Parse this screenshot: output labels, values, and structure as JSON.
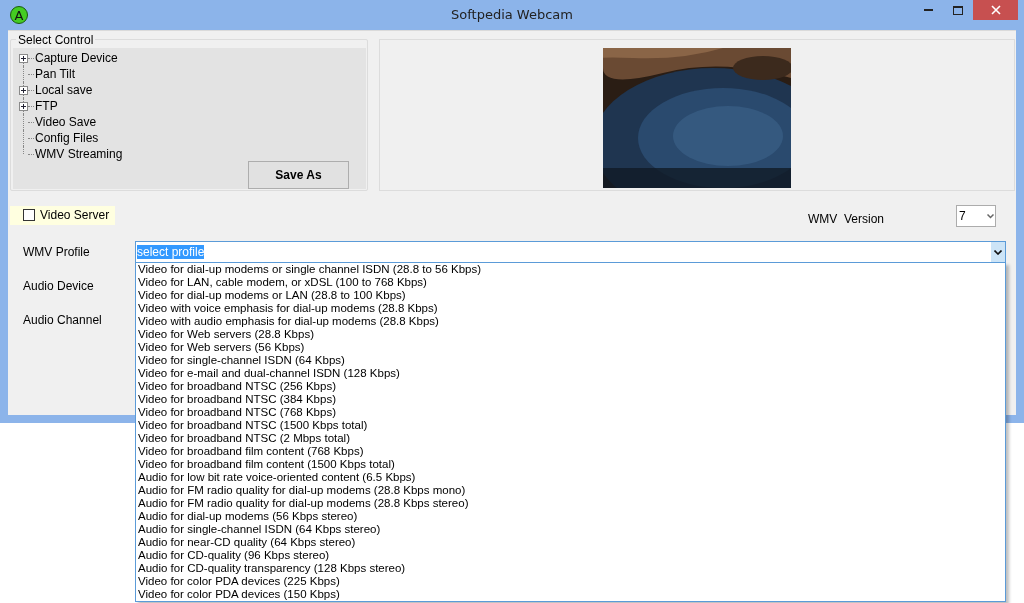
{
  "window": {
    "title": "Softpedia Webcam",
    "icon_letter": "A"
  },
  "select_control": {
    "title": "Select Control",
    "items": [
      {
        "label": "Capture Device",
        "kind": "expandable",
        "expanded": false
      },
      {
        "label": "Pan Tilt",
        "kind": "leaf"
      },
      {
        "label": "Local save",
        "kind": "expandable",
        "expanded": false
      },
      {
        "label": "FTP",
        "kind": "expandable",
        "expanded": false
      },
      {
        "label": "Video Save",
        "kind": "leaf"
      },
      {
        "label": "Config Files",
        "kind": "leaf"
      },
      {
        "label": "WMV Streaming",
        "kind": "leaf"
      }
    ],
    "save_button": "Save As"
  },
  "video_server": {
    "label": "Video Server",
    "checked": false
  },
  "wmv_version": {
    "label": "WMV  Version",
    "value": "7"
  },
  "wmv_profile": {
    "label": "WMV Profile",
    "value": "select profile",
    "expanded": true,
    "options": [
      "Video for dial-up modems or single channel ISDN (28.8 to 56 Kbps)",
      "Video for LAN, cable modem, or xDSL (100 to 768 Kbps)",
      "Video for dial-up modems or LAN (28.8 to 100 Kbps)",
      "Video with voice emphasis for dial-up modems (28.8 Kbps)",
      "Video with audio emphasis for dial-up modems (28.8 Kbps)",
      "Video for Web servers (28.8 Kbps)",
      "Video for Web servers (56 Kbps)",
      "Video for single-channel ISDN (64 Kbps)",
      "Video for e-mail and dual-channel ISDN (128 Kbps)",
      "Video for broadband NTSC (256 Kbps)",
      "Video for broadband NTSC (384 Kbps)",
      "Video for broadband NTSC (768 Kbps)",
      "Video for broadband NTSC (1500 Kbps total)",
      "Video for broadband NTSC (2 Mbps total)",
      "Video for broadband film content (768 Kbps)",
      "Video for broadband film content (1500 Kbps total)",
      "Audio for low bit rate voice-oriented content (6.5 Kbps)",
      "Audio for FM radio quality for dial-up modems (28.8 Kbps mono)",
      "Audio for FM radio quality for dial-up modems (28.8 Kbps stereo)",
      "Audio for dial-up modems (56 Kbps stereo)",
      "Audio for single-channel ISDN (64 Kbps stereo)",
      "Audio for near-CD quality (64 Kbps stereo)",
      "Audio for CD-quality (96 Kbps stereo)",
      "Audio for CD-quality transparency (128 Kbps stereo)",
      "Video for color PDA devices (225 Kbps)",
      "Video for color PDA devices (150 Kbps)"
    ]
  },
  "audio_device": {
    "label": "Audio Device"
  },
  "audio_channel": {
    "label": "Audio Channel"
  }
}
